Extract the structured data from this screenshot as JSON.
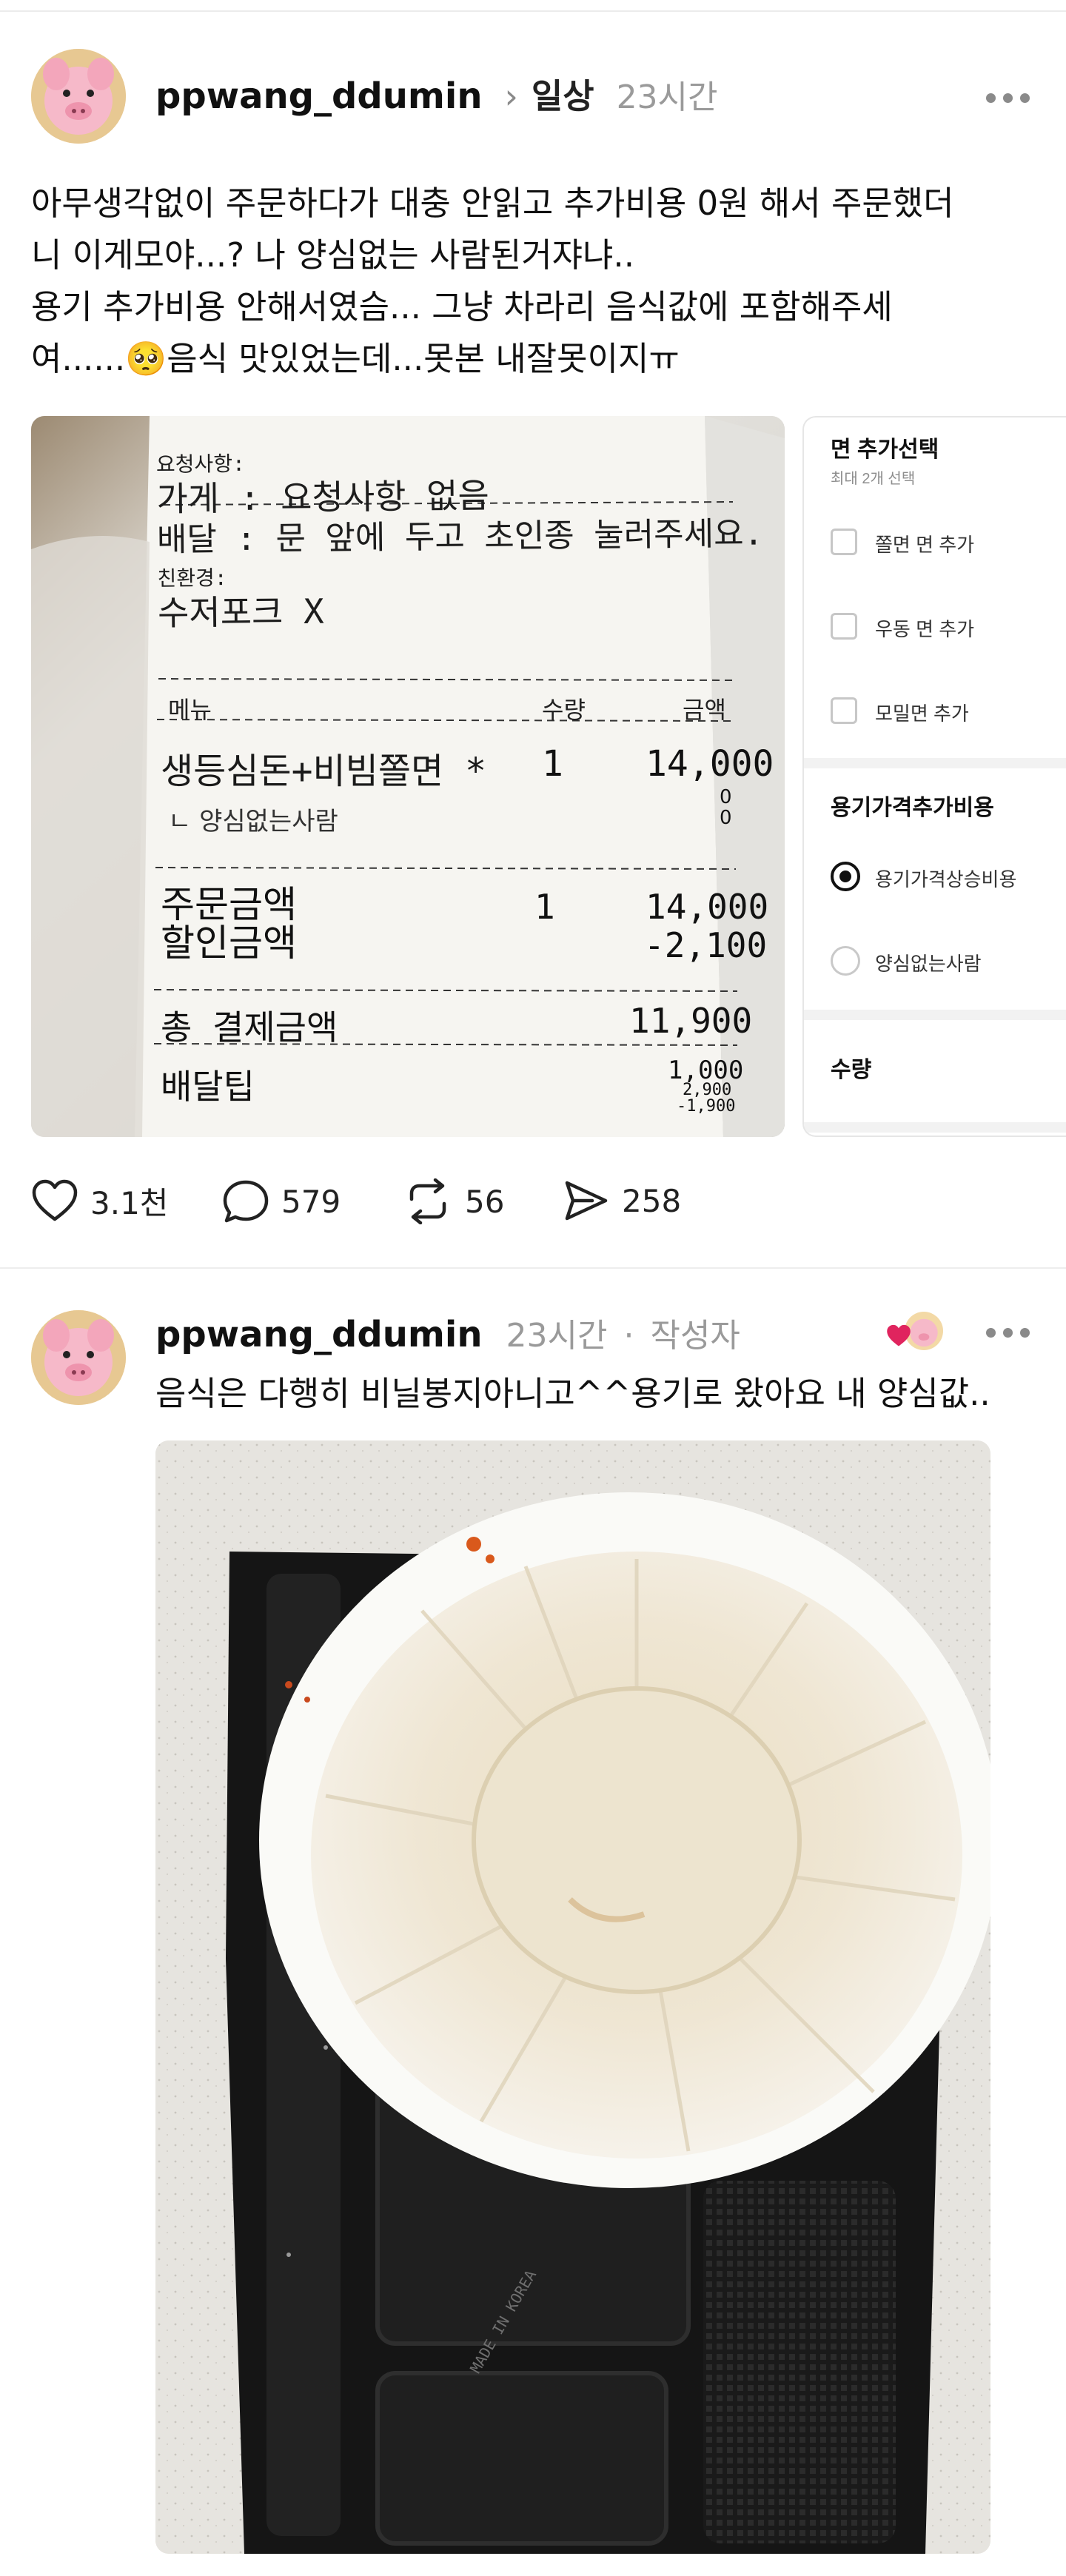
{
  "post": {
    "username": "ppwang_ddumin",
    "chevron": "›",
    "category": "일상",
    "time": "23시간",
    "text_lines": [
      "아무생각없이 주문하다가 대충 안읽고 추가비용 0원 해서 주문했더",
      "니 이게모야...? 나 양심없는 사람된거쟈냐..",
      "용기 추가비용 안해서였슴... 그냥 차라리 음식값에 포함해주세",
      "여......🥺음식 맛있었는데...못본 내잘못이지ㅠ"
    ],
    "receipt": {
      "request_label": "요청사항:",
      "store_line": "가게 : 요청사항 없음",
      "delivery_line": "배달 : 문 앞에 두고 초인종 눌러주세요.",
      "eco_label": "친환경:",
      "utensils_line": "수저포크 X",
      "col_menu": "메뉴",
      "col_qty": "수량",
      "col_amount": "금액",
      "item_name": "생등심돈+비빔쫄면 *",
      "item_qty": "1",
      "item_price": "14,000",
      "option_name": "ㄴ 양심없는사람",
      "option_price": "0",
      "option_price2": "0",
      "order_amount_label": "주문금액",
      "order_amount_qty": "1",
      "order_amount": "14,000",
      "discount_label": "할인금액",
      "discount": "-2,100",
      "total_label": "총 결제금액",
      "total": "11,900",
      "tip_label": "배달팁",
      "tip": "1,000",
      "tip_base": "2,900",
      "tip_discount": "-1,900"
    },
    "options_panel": {
      "section1_title": "면 추가선택",
      "section1_sub": "최대 2개 선택",
      "checkbox_options": [
        "쫄면 면 추가",
        "우동 면 추가",
        "모밀면 추가"
      ],
      "section2_title": "용기가격추가비용",
      "radio_options": [
        "용기가격상승비용",
        "양심없는사람"
      ],
      "selected_radio": 0,
      "section3_title": "수량"
    },
    "actions": {
      "likes": "3.1천",
      "comments": "579",
      "reposts": "56",
      "shares": "258"
    }
  },
  "reply": {
    "username": "ppwang_ddumin",
    "time": "23시간",
    "separator": "·",
    "author_badge": "작성자",
    "text": "음식은 다행히 비닐봉지아니고^^용기로 왔아요 내 양심값..",
    "tray_label": "MADE IN KOREA"
  },
  "colors": {
    "heart_badge": "#e0245e",
    "muted": "#9a9a9a",
    "tray": "#1c1c1c"
  }
}
